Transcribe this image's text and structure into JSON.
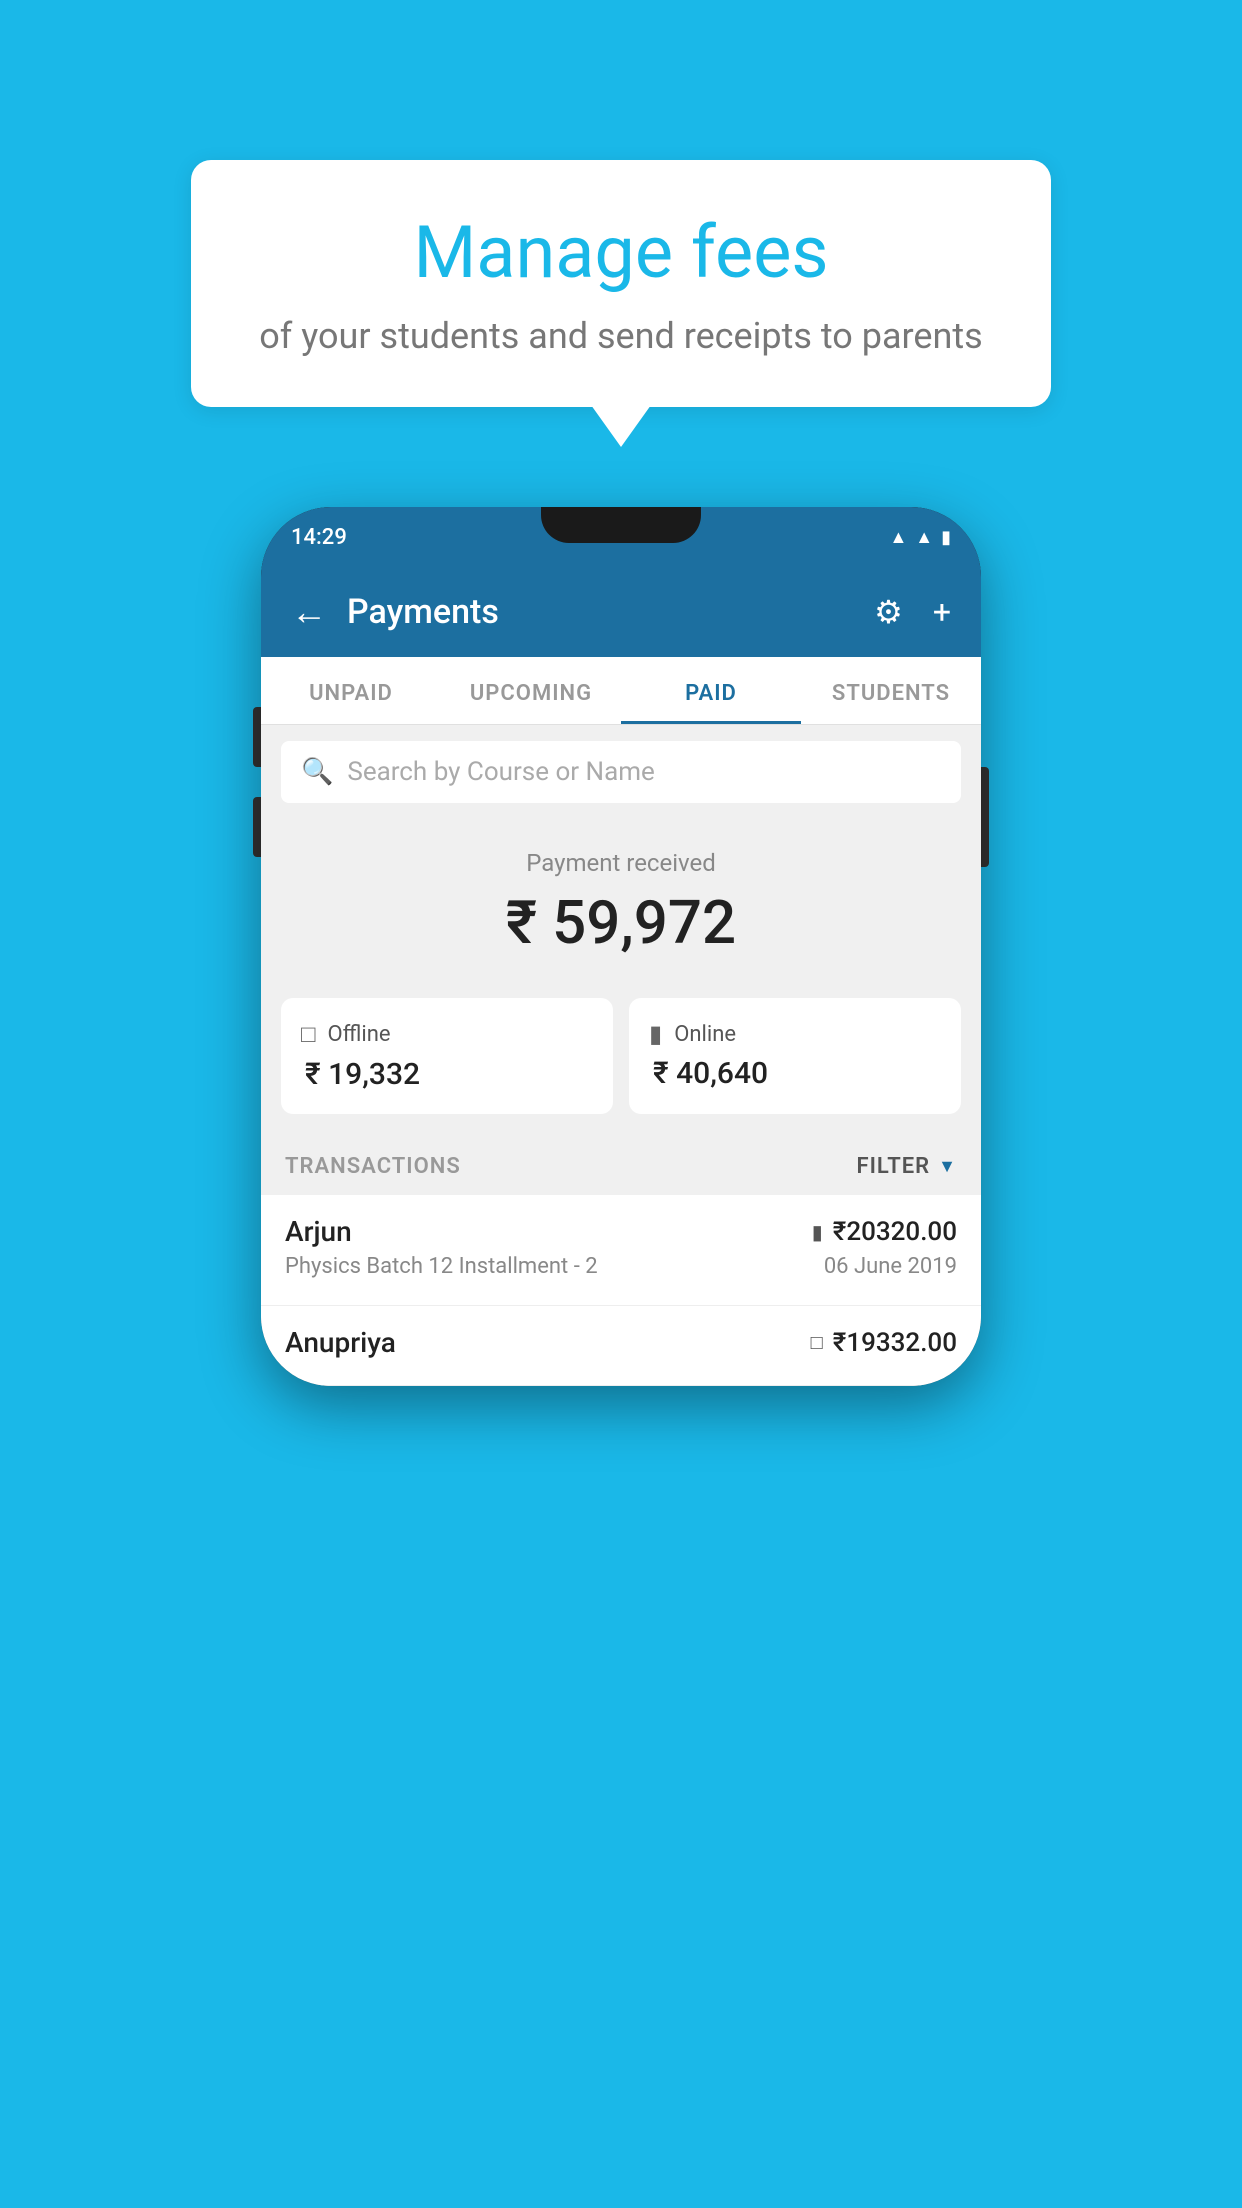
{
  "speech_bubble": {
    "title": "Manage fees",
    "subtitle": "of your students and send receipts to parents"
  },
  "phone": {
    "status_bar": {
      "time": "14:29",
      "wifi_icon": "wifi",
      "signal_icon": "signal",
      "battery_icon": "battery"
    },
    "app_bar": {
      "back_icon": "←",
      "title": "Payments",
      "settings_icon": "⚙",
      "add_icon": "+"
    },
    "tabs": [
      {
        "label": "UNPAID",
        "active": false
      },
      {
        "label": "UPCOMING",
        "active": false
      },
      {
        "label": "PAID",
        "active": true
      },
      {
        "label": "STUDENTS",
        "active": false
      }
    ],
    "search": {
      "placeholder": "Search by Course or Name",
      "search_icon": "🔍"
    },
    "payment_summary": {
      "label": "Payment received",
      "amount": "₹ 59,972",
      "offline": {
        "label": "Offline",
        "amount": "₹ 19,332",
        "icon": "offline"
      },
      "online": {
        "label": "Online",
        "amount": "₹ 40,640",
        "icon": "card"
      }
    },
    "transactions_section": {
      "label": "TRANSACTIONS",
      "filter_label": "FILTER",
      "filter_icon": "▼"
    },
    "transactions": [
      {
        "name": "Arjun",
        "course": "Physics Batch 12 Installment - 2",
        "amount": "₹20320.00",
        "date": "06 June 2019",
        "payment_type": "card"
      },
      {
        "name": "Anupriya",
        "course": "",
        "amount": "₹19332.00",
        "date": "",
        "payment_type": "offline"
      }
    ]
  },
  "colors": {
    "primary": "#1c6fa0",
    "background": "#1ab8e8",
    "white": "#ffffff",
    "gray_bg": "#f0f0f0",
    "text_dark": "#222222",
    "text_gray": "#888888"
  }
}
